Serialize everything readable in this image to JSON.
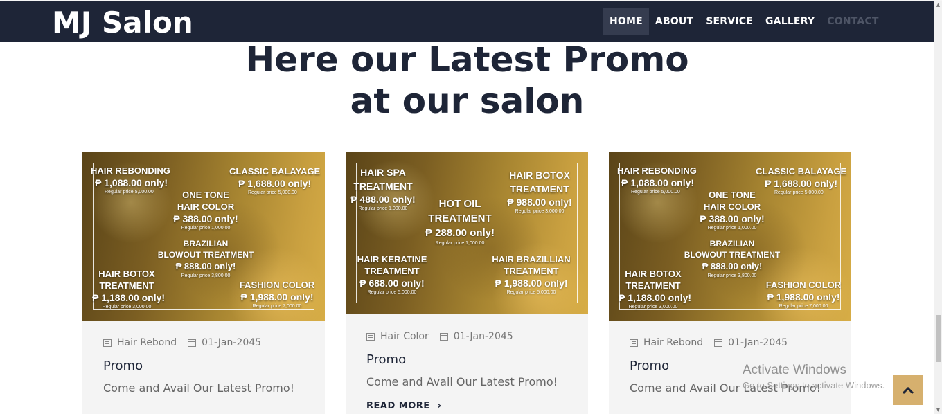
{
  "brand": "MJ Salon",
  "nav": [
    "HOME",
    "ABOUT",
    "SERVICE",
    "GALLERY",
    "CONTACT"
  ],
  "heading": {
    "line1": "Here our Latest Promo",
    "line2": "at our salon"
  },
  "posterA": {
    "rebond": {
      "name": "HAIR REBONDING",
      "price": "₱ 1,088.00 only!",
      "reg": "Regular price 5,000.00"
    },
    "balayage": {
      "name": "CLASSIC BALAYAGE",
      "price": "₱ 1,688.00 only!",
      "reg": "Regular price 5,000.00"
    },
    "onetone": {
      "name1": "ONE TONE",
      "name2": "HAIR COLOR",
      "price": "₱ 388.00 only!",
      "reg": "Regular price 1,000.00"
    },
    "brazilian": {
      "name1": "BRAZILIAN",
      "name2": "BLOWOUT TREATMENT",
      "price": "₱ 888.00 only!",
      "reg": "Regular price 3,800.00"
    },
    "botox": {
      "name1": "HAIR BOTOX",
      "name2": "TREATMENT",
      "price": "₱ 1,188.00 only!",
      "reg": "Regular price 3,000.00"
    },
    "fashion": {
      "name": "FASHION COLOR",
      "price": "₱ 1,988.00 only!",
      "reg": "Regular price 7,000.00"
    }
  },
  "posterB": {
    "spa": {
      "name1": "HAIR SPA",
      "name2": "TREATMENT",
      "price": "₱ 488.00 only!",
      "reg": "Regular price 1,000.00"
    },
    "botox": {
      "name1": "HAIR BOTOX",
      "name2": "TREATMENT",
      "price": "₱ 988.00 only!",
      "reg": "Regular price 3,000.00"
    },
    "hotoil": {
      "name1": "HOT OIL",
      "name2": "TREATMENT",
      "price": "₱ 288.00 only!",
      "reg": "Regular price 1,000.00"
    },
    "keratine": {
      "name1": "HAIR KERATINE",
      "name2": "TREATMENT",
      "price": "₱ 688.00 only!",
      "reg": "Regular price 5,000.00"
    },
    "brazillian": {
      "name1": "HAIR BRAZILLIAN",
      "name2": "TREATMENT",
      "price": "₱ 1,988.00 only!",
      "reg": "Regular price 5,000.00"
    }
  },
  "cards": [
    {
      "category": "Hair Rebond",
      "date": "01-Jan-2045",
      "title": "Promo",
      "desc": "Come and Avail Our Latest Promo!"
    },
    {
      "category": "Hair Color",
      "date": "01-Jan-2045",
      "title": "Promo",
      "desc": "Come and Avail Our Latest Promo!",
      "more": "READ MORE"
    },
    {
      "category": "Hair Rebond",
      "date": "01-Jan-2045",
      "title": "Promo",
      "desc": "Come and Avail Our Latest Promo!"
    }
  ],
  "watermark": {
    "title": "Activate Windows",
    "sub": "Go to Settings to activate Windows."
  },
  "icons": {
    "totop": "chevron-up-icon",
    "category": "list-icon",
    "date": "calendar-icon",
    "more": "chevron-right-icon"
  },
  "colors": {
    "navbar": "#1e2537",
    "accent": "#d6b06e",
    "card": "#f4f4f4"
  }
}
